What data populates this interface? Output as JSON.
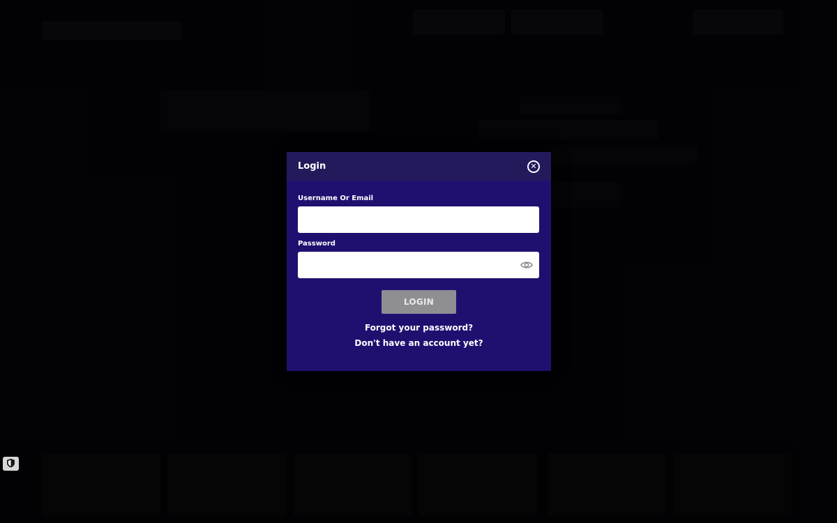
{
  "modal": {
    "title": "Login",
    "username_label": "Username Or Email",
    "username_value": "",
    "password_label": "Password",
    "password_value": "",
    "login_button": "LOGIN",
    "forgot_link": "Forgot your password?",
    "signup_link": "Don't have an account yet?"
  },
  "icons": {
    "close": "close-circle-icon",
    "password_toggle": "eye-icon",
    "privacy_badge": "shield-icon"
  },
  "colors": {
    "modal_body": "#1f1070",
    "modal_header": "#231a5c",
    "login_button": "#8e8e93",
    "overlay": "#000000"
  }
}
